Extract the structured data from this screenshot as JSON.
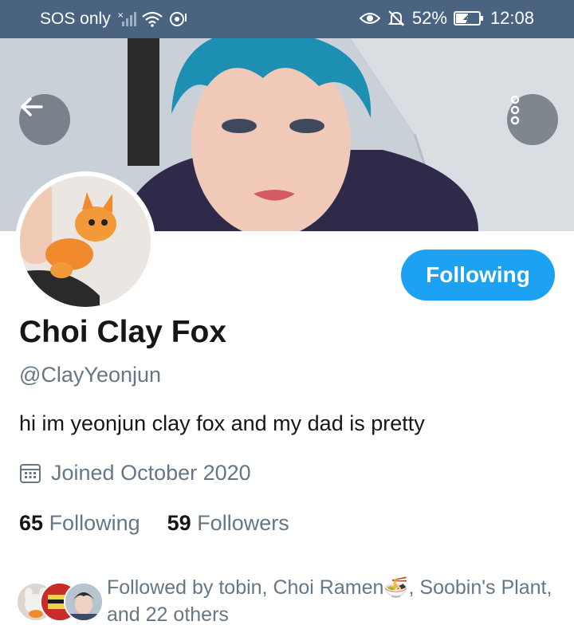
{
  "status_bar": {
    "carrier": "SOS only",
    "battery": "52%",
    "time": "12:08"
  },
  "header": {
    "back_icon": "arrow-left-icon",
    "more_icon": "vertical-dots-icon"
  },
  "profile": {
    "follow_button": "Following",
    "name": "Choi Clay Fox",
    "handle": "@ClayYeonjun",
    "bio": "hi im yeonjun clay fox and my dad is pretty",
    "joined": "Joined October 2020",
    "following_count": "65",
    "following_label": "Following",
    "followers_count": "59",
    "followers_label": "Followers",
    "followed_by": "Followed by tobin, Choi Ramen🍜, Soobin's Plant, and 22 others"
  },
  "colors": {
    "accent": "#1da1f2",
    "status_bar": "#4a6381",
    "text_primary": "#14171a",
    "text_secondary": "#657786"
  }
}
